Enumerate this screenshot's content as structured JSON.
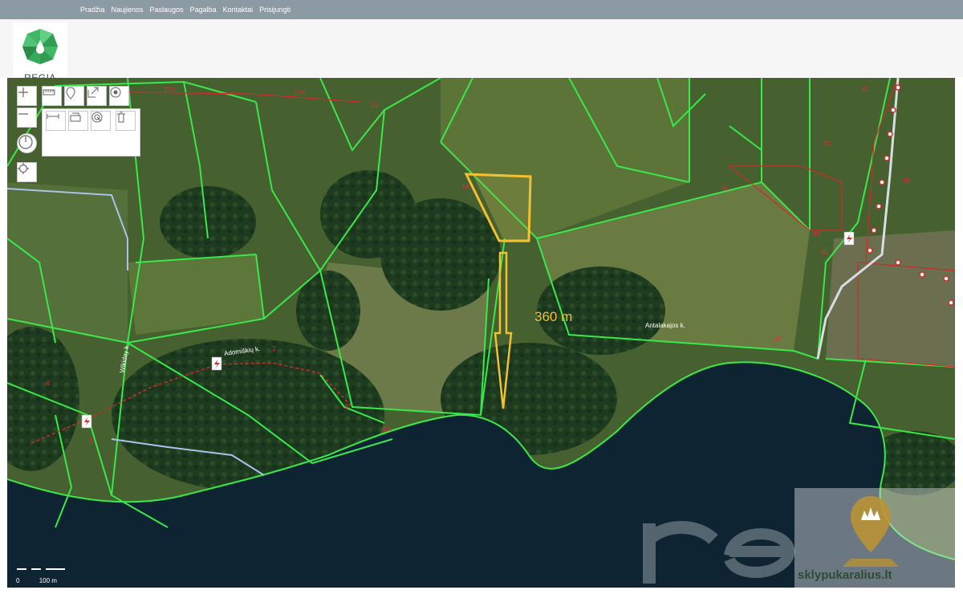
{
  "nav": {
    "items": [
      "Pradžia",
      "Naujienos",
      "Paslaugos",
      "Pagalba",
      "Kontaktai",
      "Prisijungti"
    ]
  },
  "logo": {
    "text": "REGIA"
  },
  "map": {
    "measurement_label": "360 m",
    "place_label": "Antalakajos k.",
    "village_label": "Adomiškių k.",
    "road_label": "Wikiday k.",
    "parcel_numbers": [
      "21A",
      "21A",
      "21",
      "31",
      "37",
      "1A",
      "41",
      "43",
      "45",
      "30",
      "47",
      "4",
      "3",
      "2",
      "2A",
      "1"
    ],
    "scale": {
      "zero": "0",
      "distance": "100 m"
    },
    "colors": {
      "parcel_boundary": "#39e84a",
      "selected_parcel": "#f3c12f",
      "water": "#0f2433",
      "power_line": "#cf2b2b",
      "road": "#a7c3e8"
    }
  },
  "watermark": {
    "brand": "regia",
    "site": "sklypukaralius.lt"
  },
  "toolbar": {
    "icons": [
      "zoom-in-icon",
      "zoom-out-icon",
      "compass-icon",
      "locate-icon",
      "measure-icon",
      "pin-icon",
      "share-icon",
      "target-icon",
      "ruler-icon",
      "layers-icon",
      "radar-icon",
      "trash-icon"
    ]
  }
}
